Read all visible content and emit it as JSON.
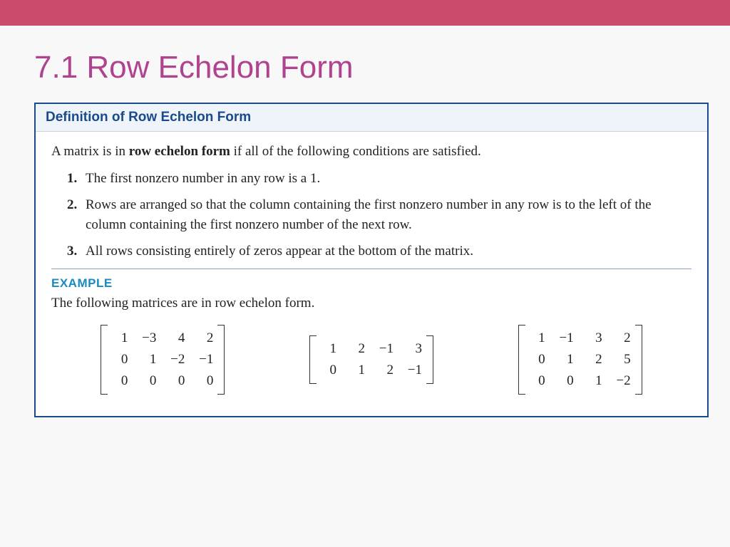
{
  "title": "7.1 Row Echelon Form",
  "box": {
    "header": "Definition of Row Echelon Form",
    "intro_pre": "A matrix is in ",
    "intro_bold": "row echelon form",
    "intro_post": " if all of the following conditions are satisfied.",
    "conditions": [
      {
        "n": "1.",
        "text": "The first nonzero number in any row is a 1."
      },
      {
        "n": "2.",
        "text": "Rows are arranged so that the column containing the first nonzero number in any row is to the left of the column containing the first nonzero number of the next row."
      },
      {
        "n": "3.",
        "text": "All rows consisting entirely of zeros appear at the bottom of the matrix."
      }
    ],
    "example_label": "EXAMPLE",
    "example_intro": "The following matrices are in row echelon form.",
    "matrices": [
      {
        "rows": 3,
        "cols": 4,
        "data": [
          "1",
          "−3",
          "4",
          "2",
          "0",
          "1",
          "−2",
          "−1",
          "0",
          "0",
          "0",
          "0"
        ]
      },
      {
        "rows": 2,
        "cols": 4,
        "data": [
          "1",
          "2",
          "−1",
          "3",
          "0",
          "1",
          "2",
          "−1"
        ]
      },
      {
        "rows": 3,
        "cols": 4,
        "data": [
          "1",
          "−1",
          "3",
          "2",
          "0",
          "1",
          "2",
          "5",
          "0",
          "0",
          "1",
          "−2"
        ]
      }
    ]
  }
}
